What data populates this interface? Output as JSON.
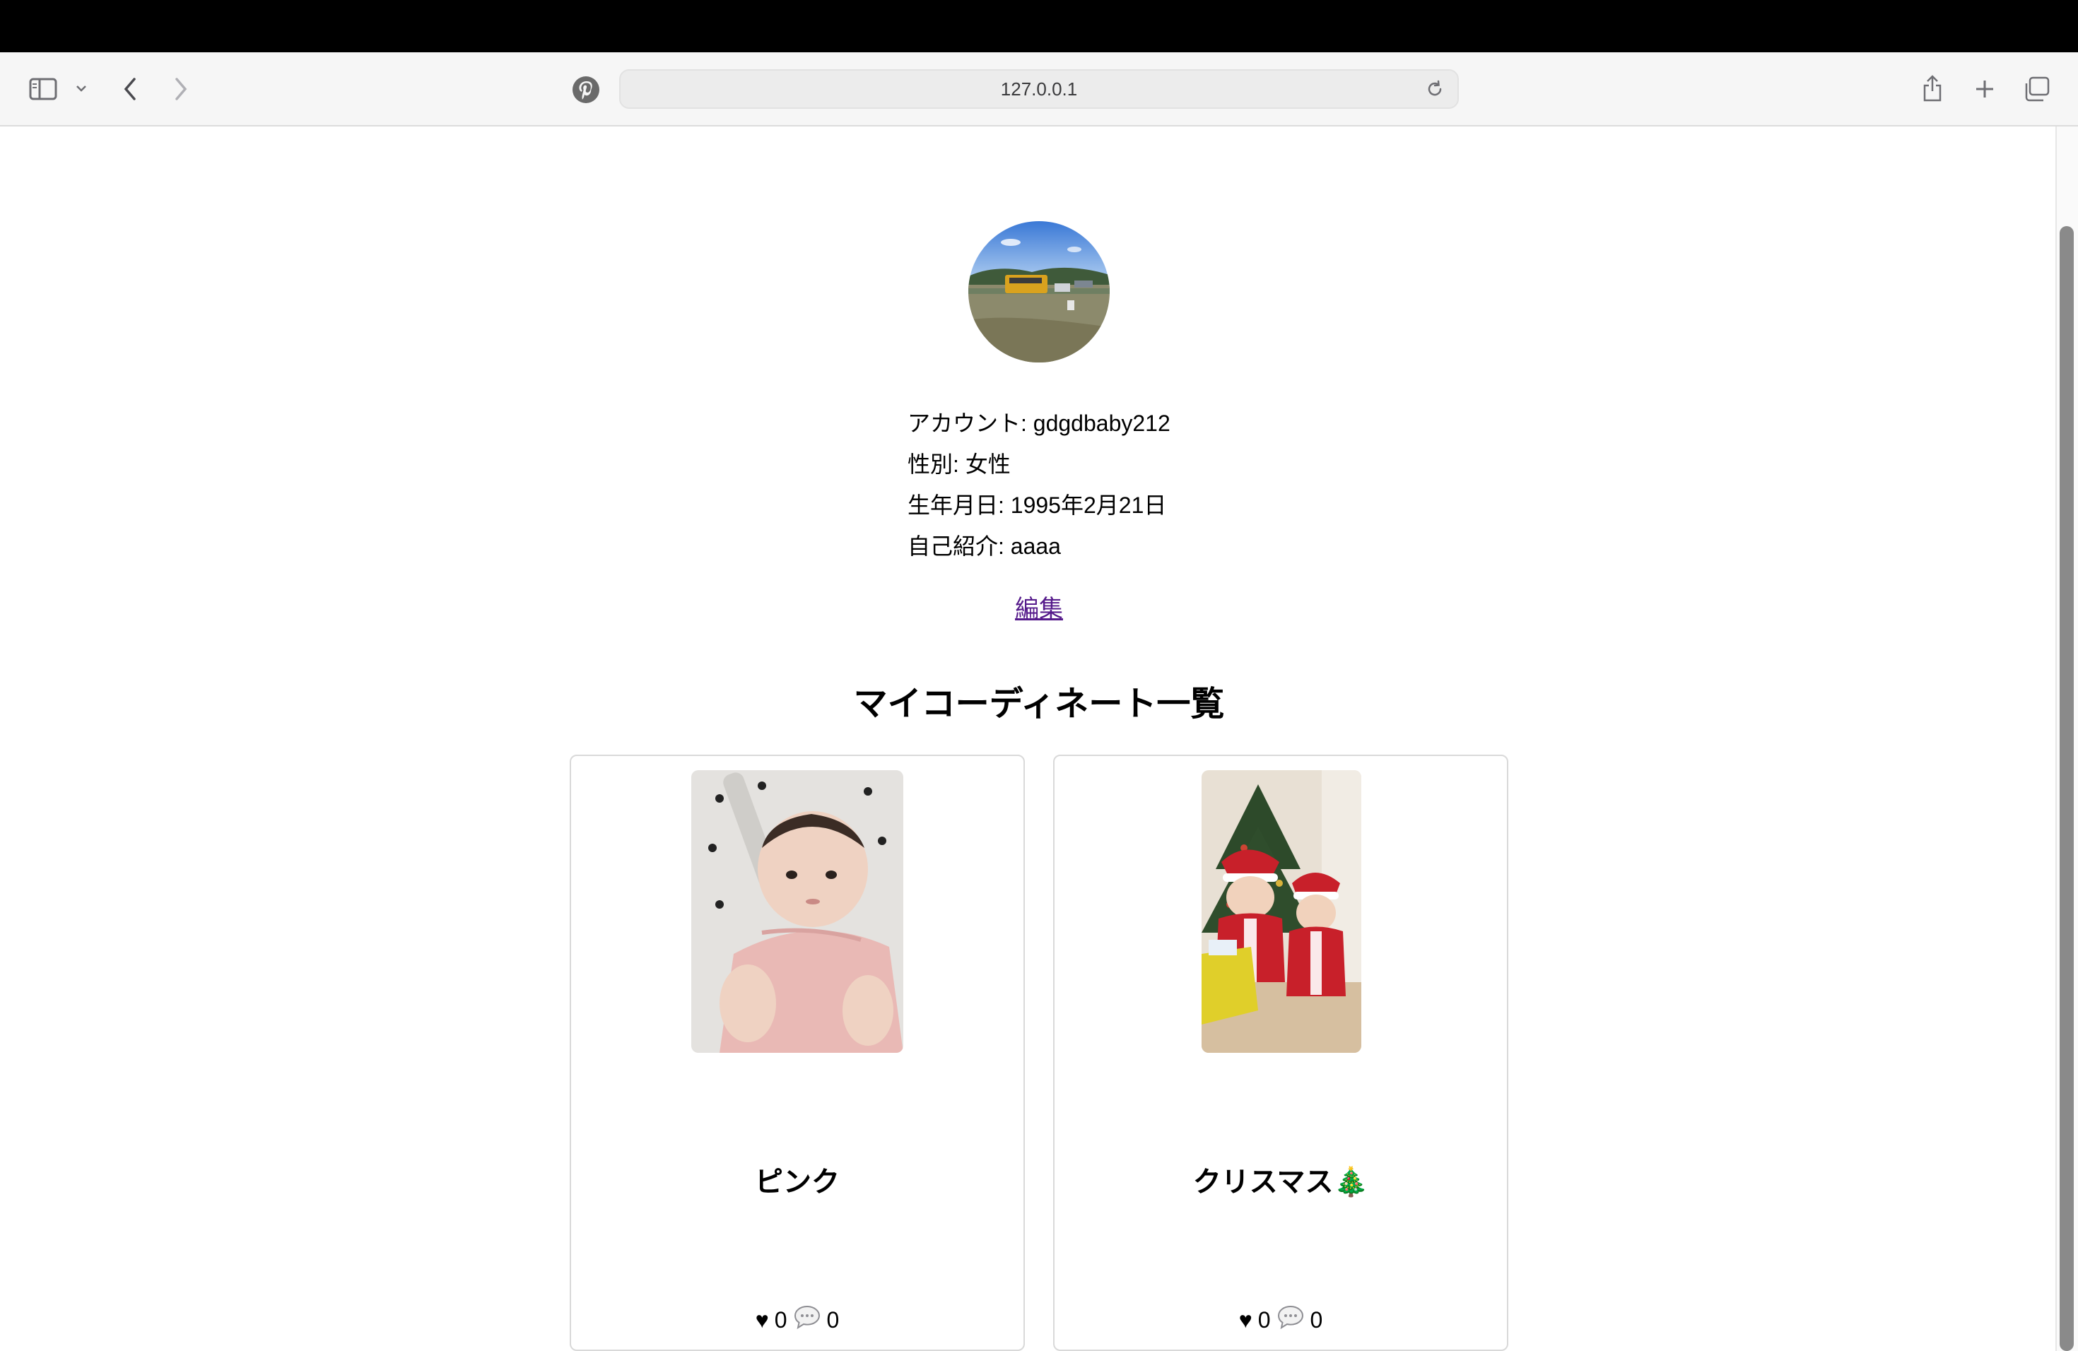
{
  "browser": {
    "url": "127.0.0.1"
  },
  "profile": {
    "account_row": "アカウント: gdgdbaby212",
    "gender_row": "性別: 女性",
    "birthday_row": "生年月日: 1995年2月21日",
    "bio_row": "自己紹介: aaaa",
    "edit_label": "編集"
  },
  "section": {
    "title": "マイコーディネート一覧"
  },
  "posts": [
    {
      "title": "ピンク",
      "likes": "0",
      "comments": "0"
    },
    {
      "title": "クリスマス🎄",
      "likes": "0",
      "comments": "0"
    }
  ],
  "icons": {
    "heart": "♥"
  },
  "colors": {
    "link": "#551a8b",
    "card_border": "#d9d9d9"
  }
}
